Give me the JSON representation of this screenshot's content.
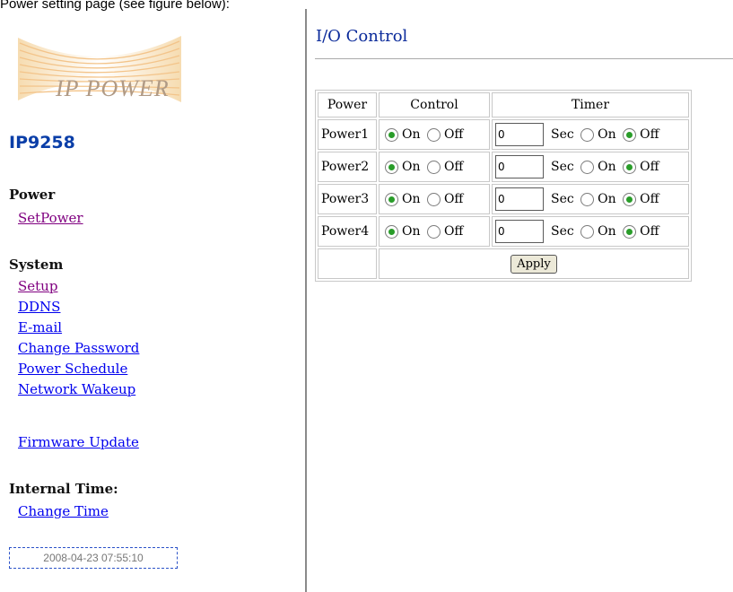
{
  "caption": "Power setting page (see figure below):",
  "sidebar": {
    "logo_text": "IP POWER",
    "model": "IP9258",
    "power": {
      "title": "Power",
      "links": [
        "SetPower"
      ]
    },
    "system": {
      "title": "System",
      "links": [
        "Setup",
        "DDNS",
        "E-mail",
        "Change Password",
        "Power Schedule",
        "Network Wakeup"
      ]
    },
    "firmware_link": "Firmware Update",
    "internal_time": {
      "title": "Internal Time:",
      "link": "Change Time"
    },
    "time_value": "2008-04-23 07:55:10"
  },
  "main": {
    "title": "I/O Control",
    "table": {
      "headers": [
        "Power",
        "Control",
        "Timer"
      ],
      "on_label": "On",
      "off_label": "Off",
      "sec_label": "Sec",
      "rows": [
        {
          "name": "Power1",
          "control": "On",
          "timer_value": "0",
          "timer_state": "Off"
        },
        {
          "name": "Power2",
          "control": "On",
          "timer_value": "0",
          "timer_state": "Off"
        },
        {
          "name": "Power3",
          "control": "On",
          "timer_value": "0",
          "timer_state": "Off"
        },
        {
          "name": "Power4",
          "control": "On",
          "timer_value": "0",
          "timer_state": "Off"
        }
      ],
      "apply_label": "Apply"
    }
  },
  "colors": {
    "accent": "#0a3ea8",
    "title": "#0a2a9a",
    "link": "#0000ee",
    "visited": "#800080",
    "radio_checked": "#2a9d2a"
  }
}
